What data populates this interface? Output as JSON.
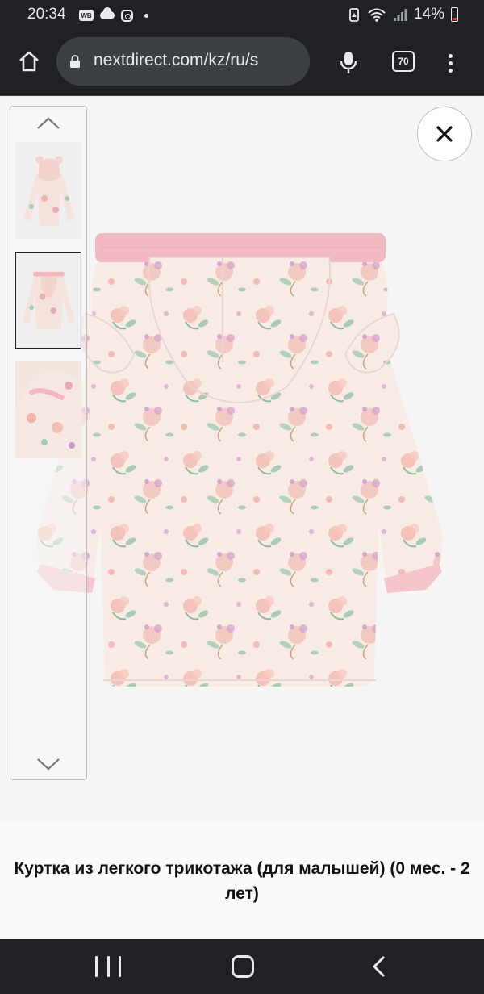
{
  "status_bar": {
    "time": "20:34",
    "notification_badge": "WB",
    "battery": "14%",
    "icons": [
      "wb-icon",
      "cloud-icon",
      "instagram-icon",
      "dot-icon",
      "recycle-icon",
      "wifi-icon",
      "signal-icon",
      "battery-icon"
    ]
  },
  "browser": {
    "url": "nextdirect.com/kz/ru/s",
    "tab_count": "70",
    "icons": [
      "home-icon",
      "lock-icon",
      "microphone-icon",
      "tabs-icon",
      "more-vert-icon"
    ]
  },
  "gallery": {
    "thumbnails": [
      {
        "alt": "front view",
        "selected": false
      },
      {
        "alt": "back view",
        "selected": true
      },
      {
        "alt": "detail view",
        "selected": false
      }
    ],
    "icons": [
      "chevron-up-icon",
      "chevron-down-icon",
      "close-icon"
    ]
  },
  "product": {
    "title": "Куртка из легкого трикотажа (для малышей) (0 мес. - 2 лет)"
  },
  "nav_bar": {
    "icons": [
      "recent-apps-icon",
      "home-circle-icon",
      "back-icon"
    ]
  },
  "colors": {
    "system_bar": "#202124",
    "url_pill": "#3c4043",
    "page_bg": "#f5f5f5",
    "jacket_base": "#f8e9e4",
    "jacket_trim": "#f2b9c2"
  }
}
